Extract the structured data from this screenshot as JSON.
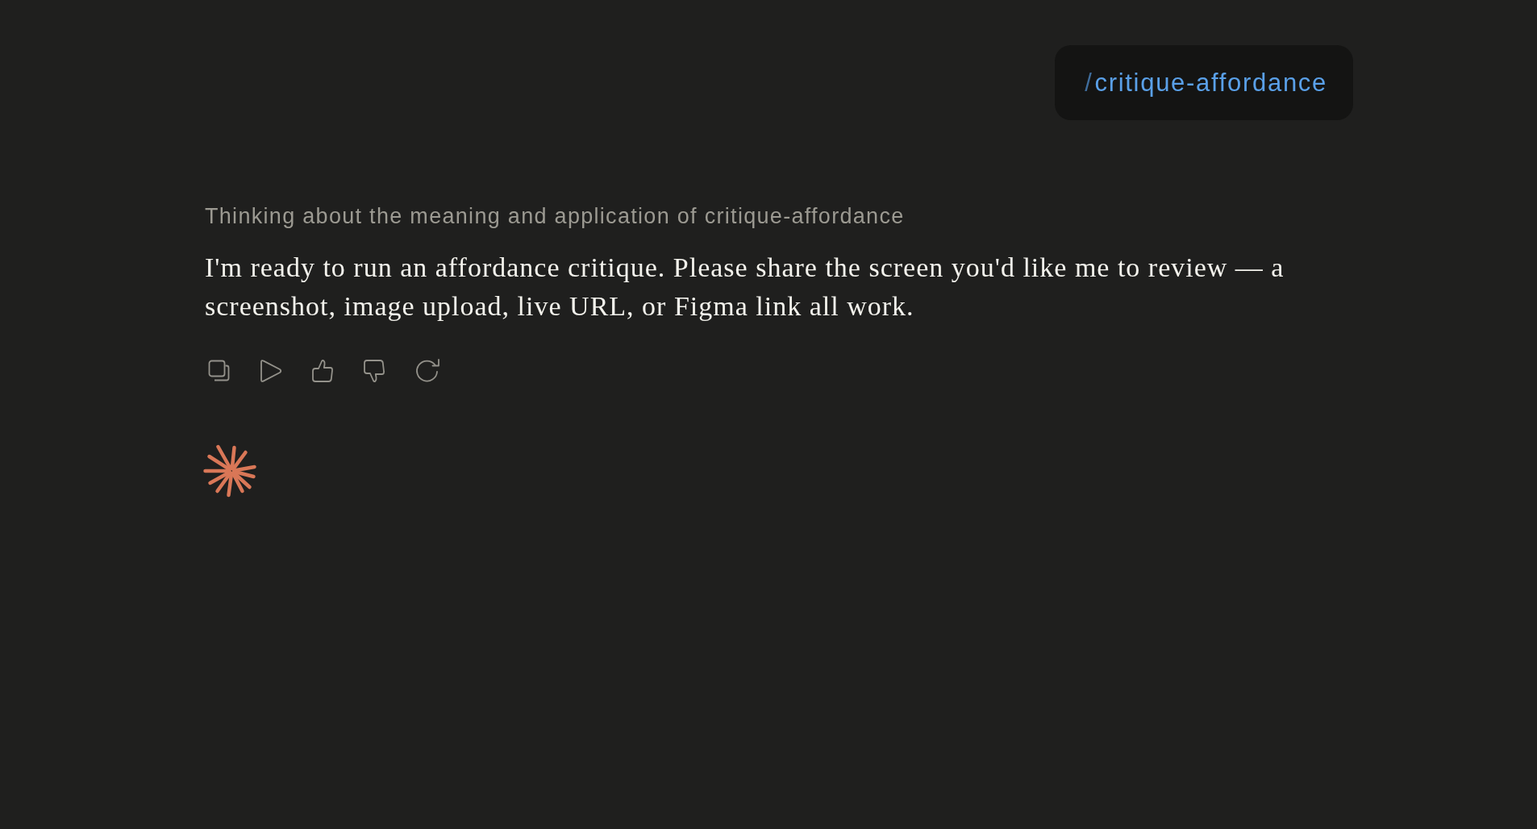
{
  "user_message": {
    "prefix": "/",
    "command": "critique-affordance"
  },
  "assistant": {
    "thinking": "Thinking about the meaning and application of critique-affordance",
    "response": "I'm ready to run an affordance critique. Please share the screen you'd like me to review — a screenshot, image upload, live URL, or Figma link all work."
  }
}
